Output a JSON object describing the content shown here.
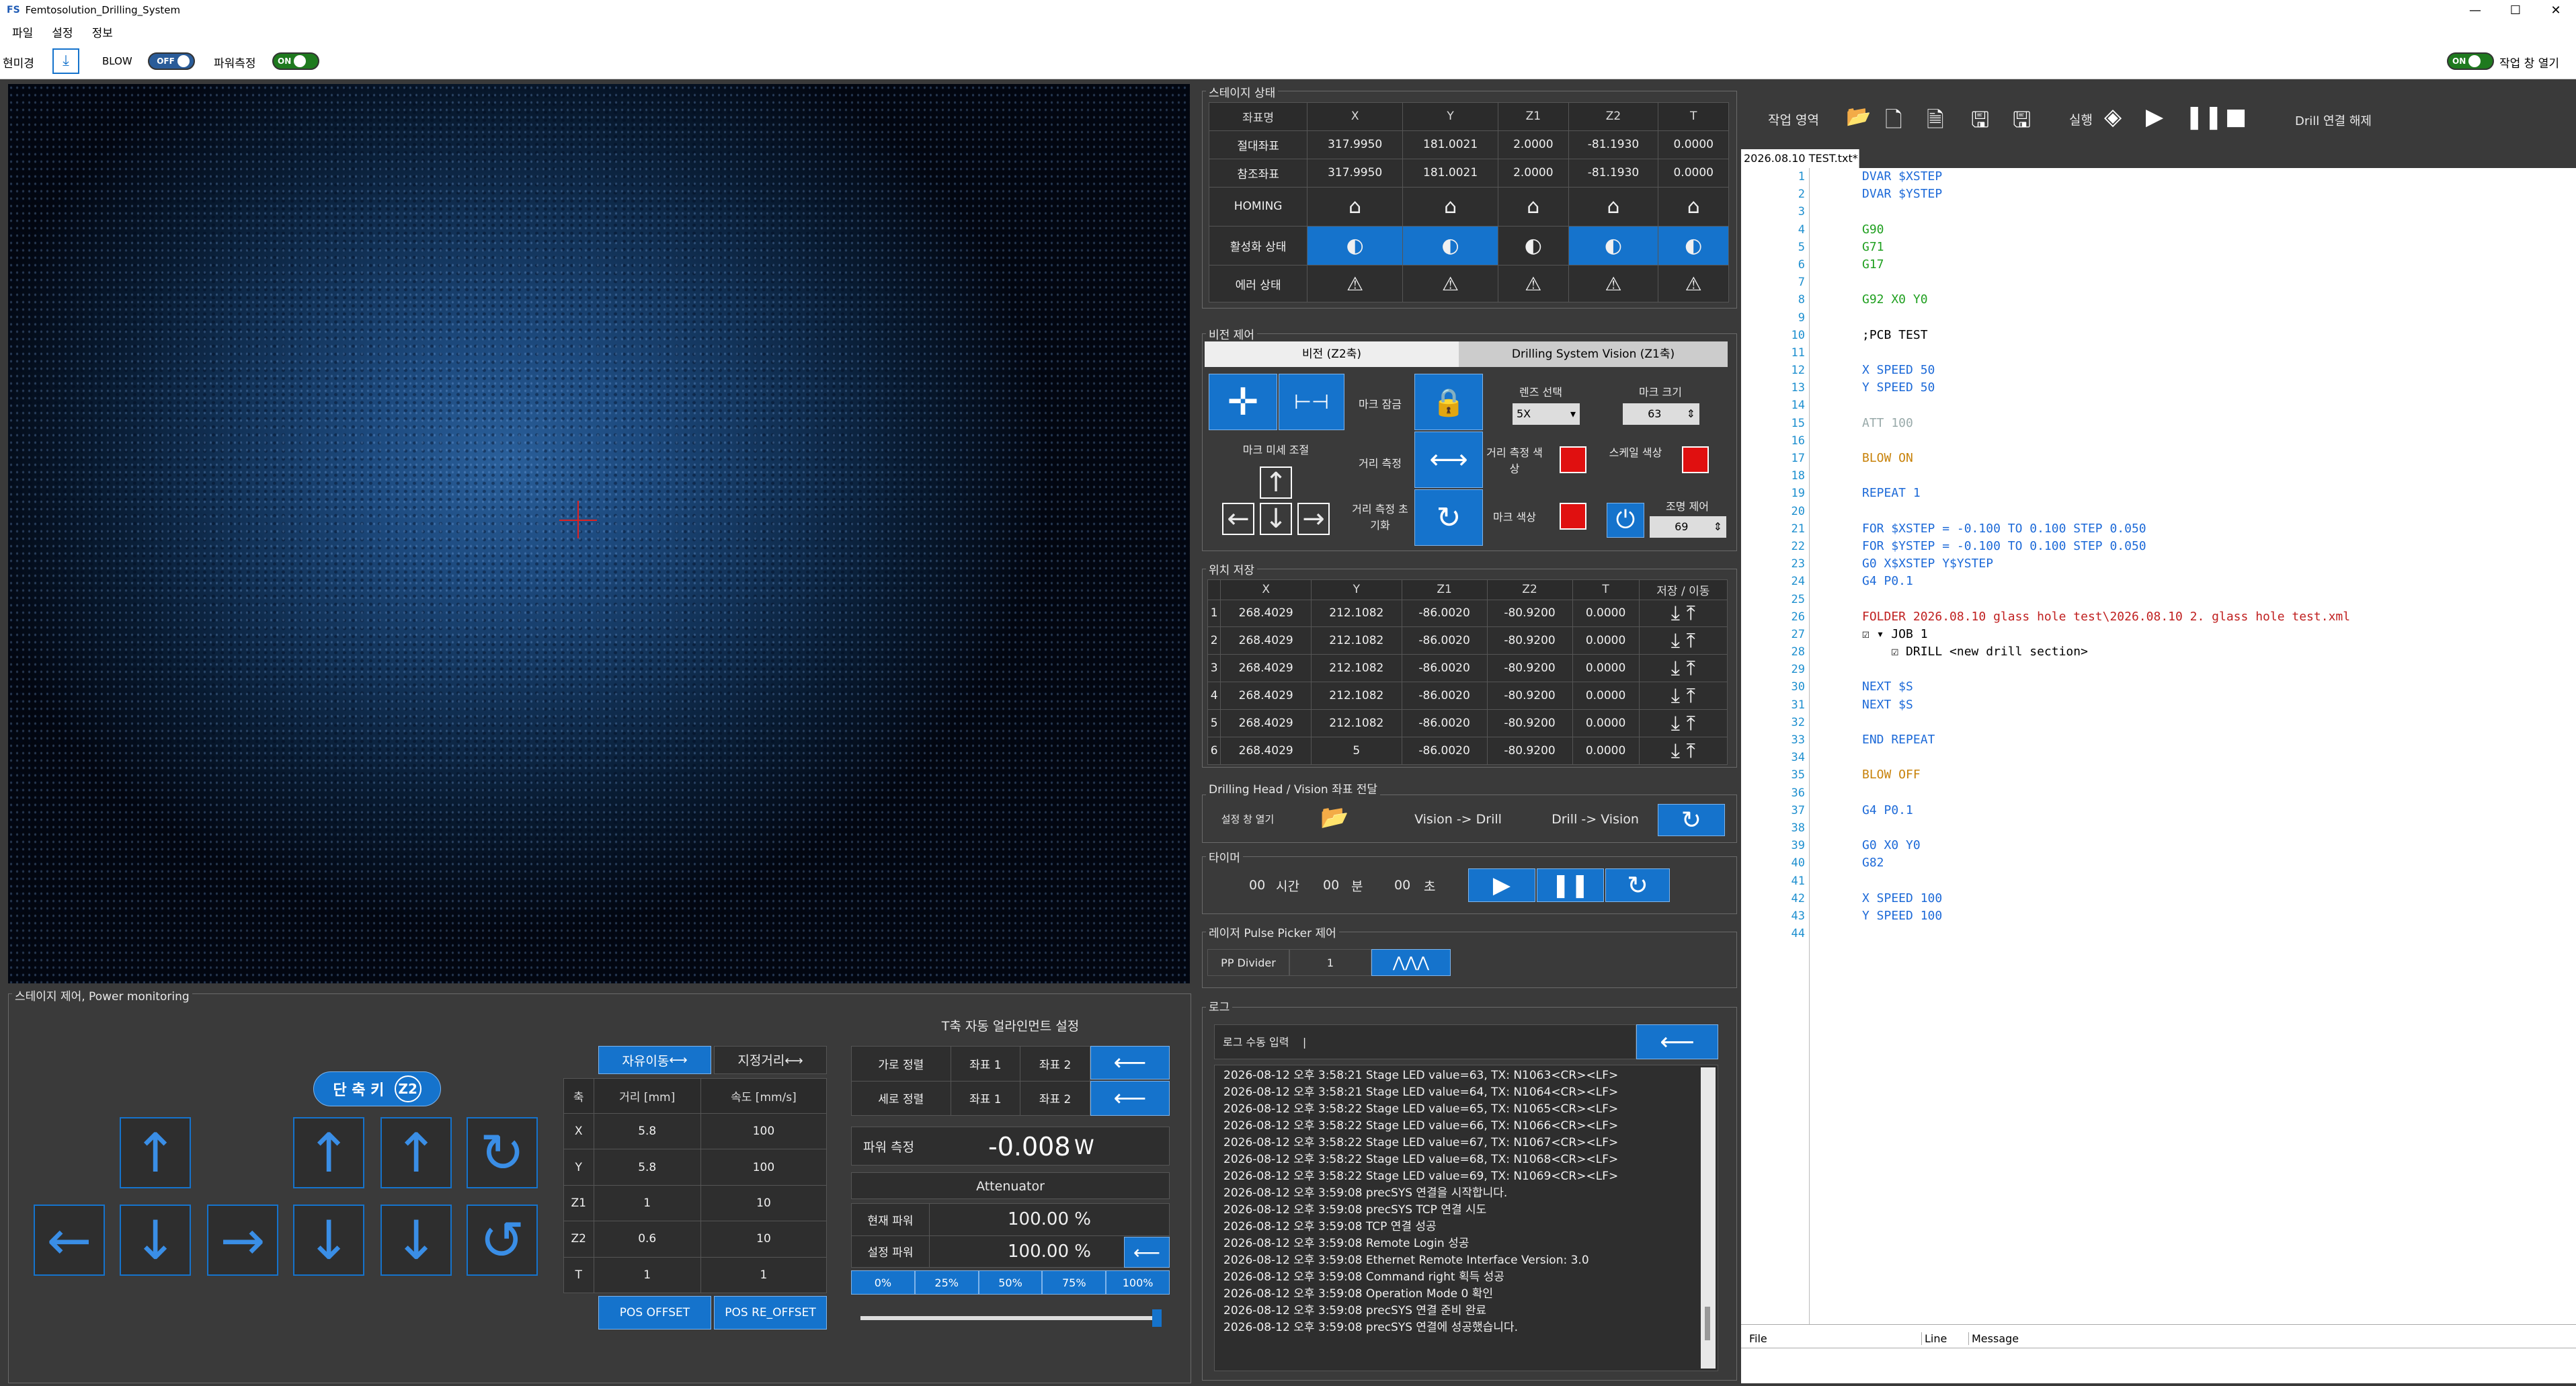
{
  "title": "Femtosolution_Drilling_System",
  "menu": [
    "파일",
    "설정",
    "정보"
  ],
  "toolbar": {
    "microscope": "현미경",
    "blow": "BLOW",
    "blow_state": "OFF",
    "power_measure": "파워측정",
    "power_state": "ON",
    "open_work": "작업 창 열기",
    "work_state": "ON"
  },
  "stage_status": {
    "title": "스테이지 상태",
    "headers": [
      "좌표명",
      "X",
      "Y",
      "Z1",
      "Z2",
      "T"
    ],
    "abs_label": "절대좌표",
    "abs": [
      "317.9950",
      "181.0021",
      "2.0000",
      "-81.1930",
      "0.0000"
    ],
    "ref_label": "참조좌표",
    "ref": [
      "317.9950",
      "181.0021",
      "2.0000",
      "-81.1930",
      "0.0000"
    ],
    "homing": "HOMING",
    "active": "활성화 상태",
    "error": "에러 상태"
  },
  "vision": {
    "title": "비전 제어",
    "tab1": "비전 (Z2축)",
    "tab2": "Drilling System Vision (Z1축)",
    "mark_lock": "마크 잠금",
    "lens": "렌즈 선택",
    "lens_val": "5X",
    "mark_size": "마크 크기",
    "mark_size_val": "63",
    "fine": "마크 미세 조절",
    "dist": "거리 측정",
    "dist_color": "거리 측정 색상",
    "scale_color": "스케일 색상",
    "dist_reset": "거리 측정 초기화",
    "mark_color": "마크 색상",
    "light": "조명 제어",
    "light_val": "69"
  },
  "pos_save": {
    "title": "위치 저장",
    "headers": [
      "",
      "X",
      "Y",
      "Z1",
      "Z2",
      "T",
      "저장 / 이동"
    ],
    "rows": [
      [
        "1",
        "268.4029",
        "212.1082",
        "-86.0020",
        "-80.9200",
        "0.0000"
      ],
      [
        "2",
        "268.4029",
        "212.1082",
        "-86.0020",
        "-80.9200",
        "0.0000"
      ],
      [
        "3",
        "268.4029",
        "212.1082",
        "-86.0020",
        "-80.9200",
        "0.0000"
      ],
      [
        "4",
        "268.4029",
        "212.1082",
        "-86.0020",
        "-80.9200",
        "0.0000"
      ],
      [
        "5",
        "268.4029",
        "212.1082",
        "-86.0020",
        "-80.9200",
        "0.0000"
      ],
      [
        "6",
        "268.4029",
        "5",
        "-86.0020",
        "-80.9200",
        "0.0000"
      ]
    ]
  },
  "transfer": {
    "title": "Drilling Head / Vision 좌표 전달",
    "open": "설정 창 열기",
    "v2d": "Vision -> Drill",
    "d2v": "Drill -> Vision"
  },
  "timer": {
    "title": "타이머",
    "h": "00",
    "hl": "시간",
    "m": "00",
    "ml": "분",
    "s": "00",
    "sl": "초"
  },
  "pulse": {
    "title": "레이저 Pulse Picker 제어",
    "label": "PP Divider",
    "value": "1"
  },
  "log": {
    "title": "로그",
    "input_label": "로그 수동 입력",
    "input_value": "|",
    "lines": [
      "2026-08-12 오후 3:58:21 Stage LED value=63, TX: N1063<CR><LF>",
      "2026-08-12 오후 3:58:21 Stage LED value=64, TX: N1064<CR><LF>",
      "2026-08-12 오후 3:58:22 Stage LED value=65, TX: N1065<CR><LF>",
      "2026-08-12 오후 3:58:22 Stage LED value=66, TX: N1066<CR><LF>",
      "2026-08-12 오후 3:58:22 Stage LED value=67, TX: N1067<CR><LF>",
      "2026-08-12 오후 3:58:22 Stage LED value=68, TX: N1068<CR><LF>",
      "2026-08-12 오후 3:58:22 Stage LED value=69, TX: N1069<CR><LF>",
      "2026-08-12 오후 3:59:08 precSYS 연결을 시작합니다.",
      "2026-08-12 오후 3:59:08 precSYS TCP 연결 시도",
      "2026-08-12 오후 3:59:08 TCP 연결 성공",
      "2026-08-12 오후 3:59:08 Remote Login 성공",
      "2026-08-12 오후 3:59:08 Ethernet Remote Interface Version: 3.0",
      "2026-08-12 오후 3:59:08 Command right 획득 성공",
      "2026-08-12 오후 3:59:08 Operation Mode 0 확인",
      "2026-08-12 오후 3:59:08 precSYS 연결 준비 완료",
      "2026-08-12 오후 3:59:08 precSYS 연결에 성공했습니다."
    ]
  },
  "work": {
    "area": "작업 영역",
    "run": "실행",
    "disconnect": "Drill 연결 해제",
    "tab": "2026.08.10 TEST.txt*",
    "footer": [
      "File",
      "Line",
      "Message"
    ]
  },
  "code": [
    [
      "DVAR $XSTEP",
      "kw"
    ],
    [
      "DVAR $YSTEP",
      "kw"
    ],
    [
      "",
      ""
    ],
    [
      "G90",
      "gr"
    ],
    [
      "G71",
      "gr"
    ],
    [
      "G17",
      "gr"
    ],
    [
      "",
      ""
    ],
    [
      "G92 X0 Y0",
      "gr"
    ],
    [
      "",
      ""
    ],
    [
      ";PCB TEST",
      "cm"
    ],
    [
      "",
      ""
    ],
    [
      "X SPEED 50",
      "kw"
    ],
    [
      "Y SPEED 50",
      "kw"
    ],
    [
      "",
      ""
    ],
    [
      "ATT 100",
      "gy"
    ],
    [
      "",
      ""
    ],
    [
      "BLOW ON",
      "or"
    ],
    [
      "",
      ""
    ],
    [
      "REPEAT 1",
      "kw"
    ],
    [
      "",
      ""
    ],
    [
      "FOR $XSTEP = -0.100 TO 0.100 STEP 0.050",
      "kw"
    ],
    [
      "FOR $YSTEP = -0.100 TO 0.100 STEP 0.050",
      "kw"
    ],
    [
      "G0 X$XSTEP Y$YSTEP",
      "kw"
    ],
    [
      "G4 P0.1",
      "kw"
    ],
    [
      "",
      ""
    ],
    [
      "FOLDER 2026.08.10 glass hole test\\2026.08.10 2. glass hole test.xml",
      "rd"
    ],
    [
      "☑ ▾ JOB 1",
      "cm"
    ],
    [
      "    ☑ DRILL <new drill section>",
      "cm"
    ],
    [
      "",
      ""
    ],
    [
      "NEXT $S",
      "kw"
    ],
    [
      "NEXT $S",
      "kw"
    ],
    [
      "",
      ""
    ],
    [
      "END REPEAT",
      "kw"
    ],
    [
      "",
      ""
    ],
    [
      "BLOW OFF",
      "or"
    ],
    [
      "",
      ""
    ],
    [
      "G4 P0.1",
      "kw"
    ],
    [
      "",
      ""
    ],
    [
      "G0 X0 Y0",
      "kw"
    ],
    [
      "G82",
      "kw"
    ],
    [
      "",
      ""
    ],
    [
      "X SPEED 100",
      "kw"
    ],
    [
      "Y SPEED 100",
      "kw"
    ],
    [
      "",
      ""
    ]
  ],
  "stage_ctrl": {
    "title": "스테이지 제어, Power monitoring",
    "shortcut": "단 축 키",
    "shortcut_badge": "Z2",
    "free_move": "자유이동",
    "fixed_dist": "지정거리",
    "axis": "축",
    "dist": "거리 [mm]",
    "speed": "속도 [mm/s]",
    "rows": [
      [
        "X",
        "5.8",
        "100"
      ],
      [
        "Y",
        "5.8",
        "100"
      ],
      [
        "Z1",
        "1",
        "10"
      ],
      [
        "Z2",
        "0.6",
        "10"
      ],
      [
        "T",
        "1",
        "1"
      ]
    ],
    "pos_offset": "POS OFFSET",
    "pos_reoffset": "POS RE_OFFSET"
  },
  "t_align": {
    "title": "T축 자동 얼라인먼트 설정",
    "h_align": "가로 정렬",
    "v_align": "세로 정렬",
    "c1": "좌표 1",
    "c2": "좌표 2",
    "power_label": "파워 측정",
    "power_value": "-0.008",
    "power_unit": "W",
    "attenuator": "Attenuator",
    "cur_power": "현재 파워",
    "cur_value": "100.00 %",
    "set_power": "설정 파워",
    "set_value": "100.00 %",
    "pcts": [
      "0%",
      "25%",
      "50%",
      "75%",
      "100%"
    ],
    "slider": 1.0
  }
}
